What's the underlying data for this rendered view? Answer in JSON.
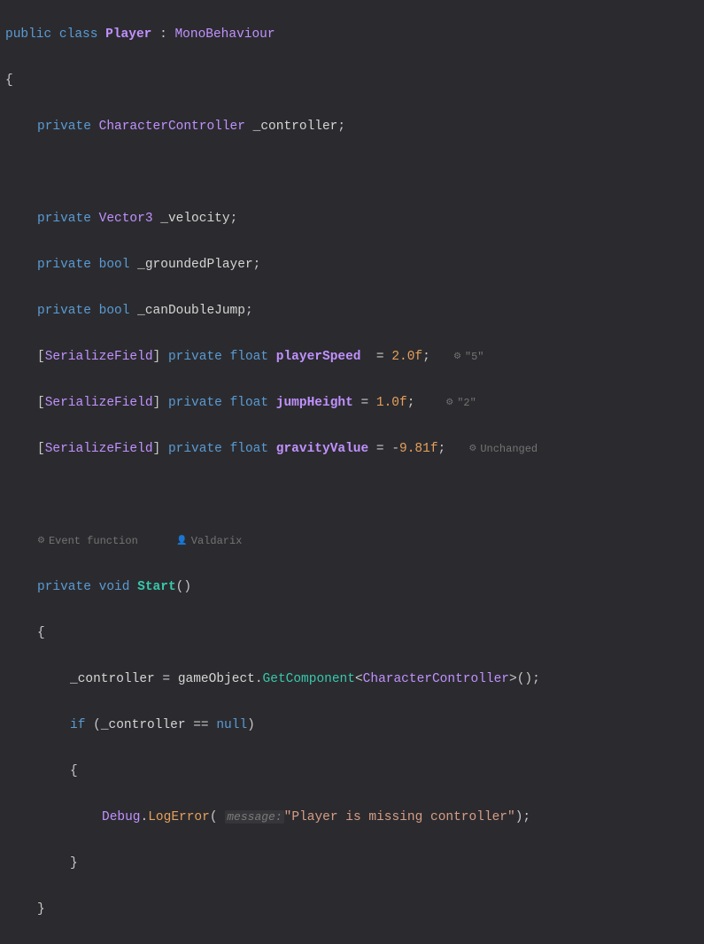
{
  "code": {
    "modifier_public": "public",
    "modifier_private": "private",
    "kw_class": "class",
    "kw_void": "void",
    "kw_bool": "bool",
    "kw_float": "float",
    "kw_if": "if",
    "kw_null": "null",
    "class_name": "Player",
    "base_class": "MonoBehaviour",
    "type_CharacterController": "CharacterController",
    "type_Vector3": "Vector3",
    "type_SerializeField": "SerializeField",
    "type_Debug": "Debug",
    "field_controller": "_controller",
    "field_velocity": "_velocity",
    "field_groundedPlayer": "_groundedPlayer",
    "field_canDoubleJump": "_canDoubleJump",
    "field_playerSpeed": "playerSpeed",
    "field_jumpHeight": "jumpHeight",
    "field_gravityValue": "gravityValue",
    "val_playerSpeed": "2.0f",
    "val_jumpHeight": "1.0f",
    "val_gravityValue": "9.81f",
    "method_Start": "Start",
    "ident_gameObject": "gameObject",
    "call_GetComponent": "GetComponent",
    "call_LogError": "LogError",
    "paramhint_message": "message:",
    "string_error": "\"Player is missing controller\"",
    "sym_colon": ":",
    "sym_obrace": "{",
    "sym_cbrace": "}",
    "sym_obracket": "[",
    "sym_cbracket": "]",
    "sym_oparen": "(",
    "sym_cparen": ")",
    "sym_lt": "<",
    "sym_gt": ">",
    "sym_semi": ";",
    "sym_eq": "=",
    "sym_eqeq": "==",
    "sym_dot": ".",
    "sym_minus": "-",
    "sym_empty": "()"
  },
  "annotations": {
    "unity_icon": "⚙",
    "user_icon": "👤",
    "playerSpeed_override": "\"5\"",
    "jumpHeight_override": "\"2\"",
    "gravity_unchanged": "Unchanged",
    "event_function": "Event function",
    "author": "Valdarix"
  }
}
